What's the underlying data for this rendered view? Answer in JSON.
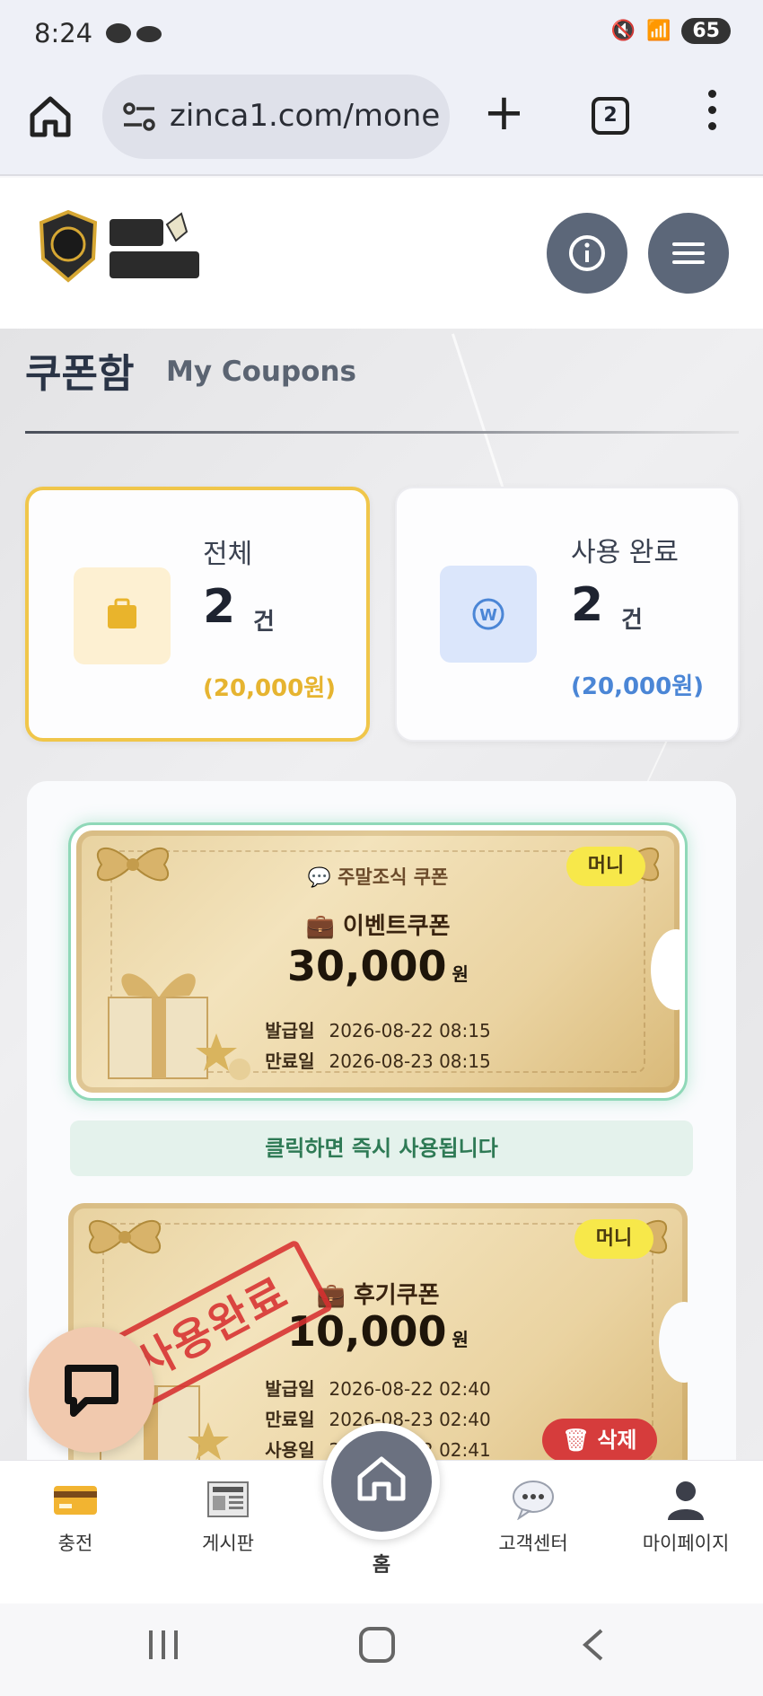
{
  "status": {
    "time": "8:24",
    "battery": "65"
  },
  "browser": {
    "url": "zinca1.com/mone",
    "tab_count": "2"
  },
  "page": {
    "title": "쿠폰함",
    "subtitle": "My Coupons"
  },
  "stats": {
    "total": {
      "label": "전체",
      "count": "2",
      "unit": "건",
      "amount": "(20,000원)",
      "color": "#e6b430"
    },
    "used": {
      "label": "사용 완료",
      "count": "2",
      "unit": "건",
      "amount": "(20,000원)",
      "color": "#4b86d6"
    }
  },
  "coupons": [
    {
      "type_label": "주말조식 쿠폰",
      "name": "이벤트쿠폰",
      "amount": "30,000",
      "currency": "원",
      "badge": "머니",
      "issued_label": "발급일",
      "issued": "2026-08-22 08:15",
      "expires_label": "만료일",
      "expires": "2026-08-23 08:15",
      "hint": "클릭하면 즉시 사용됩니다"
    },
    {
      "name": "후기쿠폰",
      "amount": "10,000",
      "currency": "원",
      "badge": "머니",
      "stamp": "사용완료",
      "issued_label": "발급일",
      "issued": "2026-08-22 02:40",
      "expires_label": "만료일",
      "expires": "2026-08-23 02:40",
      "used_label": "사용일",
      "used": "2026-08-22 02:41",
      "delete_label": "삭제"
    }
  ],
  "nav": {
    "items": [
      {
        "label": "충전",
        "icon": "card-icon"
      },
      {
        "label": "게시판",
        "icon": "newspaper-icon"
      },
      {
        "label": "홈",
        "icon": "home-icon"
      },
      {
        "label": "고객센터",
        "icon": "chat-bubble-icon"
      },
      {
        "label": "마이페이지",
        "icon": "user-icon"
      }
    ]
  }
}
